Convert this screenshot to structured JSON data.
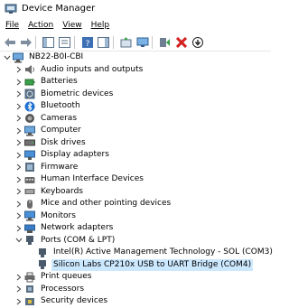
{
  "window": {
    "title": "Device Manager"
  },
  "menu": [
    {
      "label": "File"
    },
    {
      "label": "Action"
    },
    {
      "label": "View"
    },
    {
      "label": "Help"
    }
  ],
  "toolbar": [
    {
      "icon": "back-arrow-icon"
    },
    {
      "icon": "forward-arrow-icon"
    },
    {
      "icon": "show-hide-console-tree-icon"
    },
    {
      "icon": "properties-icon"
    },
    {
      "icon": "help-icon"
    },
    {
      "icon": "action-pane-icon"
    },
    {
      "icon": "update-driver-icon"
    },
    {
      "icon": "monitor-scan-icon"
    },
    {
      "icon": "enable-device-icon"
    },
    {
      "icon": "uninstall-device-icon"
    },
    {
      "icon": "disable-device-icon"
    }
  ],
  "tree": {
    "root": {
      "label": "NB22-B0I-CBI",
      "expanded": true
    },
    "categories": [
      {
        "label": "Audio inputs and outputs",
        "icon": "speaker-icon"
      },
      {
        "label": "Batteries",
        "icon": "battery-icon"
      },
      {
        "label": "Biometric devices",
        "icon": "fingerprint-icon"
      },
      {
        "label": "Bluetooth",
        "icon": "bluetooth-icon"
      },
      {
        "label": "Cameras",
        "icon": "camera-icon"
      },
      {
        "label": "Computer",
        "icon": "computer-icon"
      },
      {
        "label": "Disk drives",
        "icon": "disk-drive-icon"
      },
      {
        "label": "Display adapters",
        "icon": "display-adapter-icon"
      },
      {
        "label": "Firmware",
        "icon": "firmware-icon"
      },
      {
        "label": "Human Interface Devices",
        "icon": "hid-icon"
      },
      {
        "label": "Keyboards",
        "icon": "keyboard-icon"
      },
      {
        "label": "Mice and other pointing devices",
        "icon": "mouse-icon"
      },
      {
        "label": "Monitors",
        "icon": "monitor-icon"
      },
      {
        "label": "Network adapters",
        "icon": "network-adapter-icon"
      },
      {
        "label": "Ports (COM & LPT)",
        "icon": "port-icon",
        "expanded": true
      },
      {
        "label": "Print queues",
        "icon": "printer-icon"
      },
      {
        "label": "Processors",
        "icon": "processor-icon"
      },
      {
        "label": "Security devices",
        "icon": "security-device-icon"
      }
    ],
    "ports_children": [
      {
        "label": "Intel(R) Active Management Technology - SOL (COM3)",
        "icon": "port-icon"
      },
      {
        "label": "Silicon Labs CP210x USB to UART Bridge (COM4)",
        "icon": "port-icon",
        "selected": true
      }
    ]
  },
  "colors": {
    "selection": "#cce8ff",
    "chevron": "#404040",
    "port_icon": "#4a5a6a"
  }
}
